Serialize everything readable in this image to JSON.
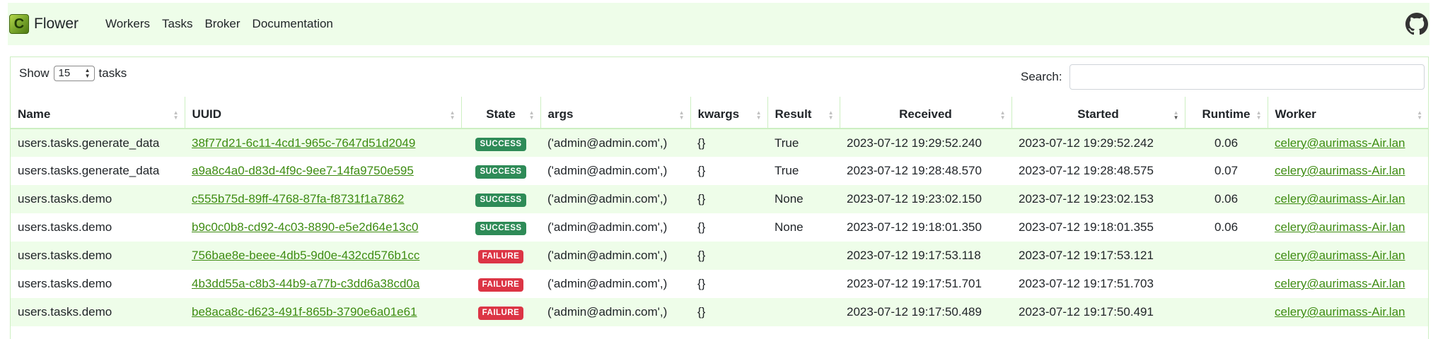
{
  "navbar": {
    "logo_letter": "C",
    "brand": "Flower",
    "links": [
      "Workers",
      "Tasks",
      "Broker",
      "Documentation"
    ],
    "github_icon": "github-icon"
  },
  "controls": {
    "show_label": "Show",
    "page_size": "15",
    "tasks_label": "tasks",
    "search_label": "Search:",
    "search_value": ""
  },
  "table": {
    "columns": [
      "Name",
      "UUID",
      "State",
      "args",
      "kwargs",
      "Result",
      "Received",
      "Started",
      "Runtime",
      "Worker"
    ],
    "sorted_column": "Started",
    "sort_direction": "descending",
    "rows": [
      {
        "name": "users.tasks.generate_data",
        "uuid": "38f77d21-6c11-4cd1-965c-7647d51d2049",
        "state": "SUCCESS",
        "args": "('admin@admin.com',)",
        "kwargs": "{}",
        "result": "True",
        "received": "2023-07-12 19:29:52.240",
        "started": "2023-07-12 19:29:52.242",
        "runtime": "0.06",
        "worker": "celery@aurimass-Air.lan"
      },
      {
        "name": "users.tasks.generate_data",
        "uuid": "a9a8c4a0-d83d-4f9c-9ee7-14fa9750e595",
        "state": "SUCCESS",
        "args": "('admin@admin.com',)",
        "kwargs": "{}",
        "result": "True",
        "received": "2023-07-12 19:28:48.570",
        "started": "2023-07-12 19:28:48.575",
        "runtime": "0.07",
        "worker": "celery@aurimass-Air.lan"
      },
      {
        "name": "users.tasks.demo",
        "uuid": "c555b75d-89ff-4768-87fa-f8731f1a7862",
        "state": "SUCCESS",
        "args": "('admin@admin.com',)",
        "kwargs": "{}",
        "result": "None",
        "received": "2023-07-12 19:23:02.150",
        "started": "2023-07-12 19:23:02.153",
        "runtime": "0.06",
        "worker": "celery@aurimass-Air.lan"
      },
      {
        "name": "users.tasks.demo",
        "uuid": "b9c0c0b8-cd92-4c03-8890-e5e2d64e13c0",
        "state": "SUCCESS",
        "args": "('admin@admin.com',)",
        "kwargs": "{}",
        "result": "None",
        "received": "2023-07-12 19:18:01.350",
        "started": "2023-07-12 19:18:01.355",
        "runtime": "0.06",
        "worker": "celery@aurimass-Air.lan"
      },
      {
        "name": "users.tasks.demo",
        "uuid": "756bae8e-beee-4db5-9d0e-432cd576b1cc",
        "state": "FAILURE",
        "args": "('admin@admin.com',)",
        "kwargs": "{}",
        "result": "",
        "received": "2023-07-12 19:17:53.118",
        "started": "2023-07-12 19:17:53.121",
        "runtime": "",
        "worker": "celery@aurimass-Air.lan"
      },
      {
        "name": "users.tasks.demo",
        "uuid": "4b3dd55a-c8b3-44b9-a77b-c3dd6a38cd0a",
        "state": "FAILURE",
        "args": "('admin@admin.com',)",
        "kwargs": "{}",
        "result": "",
        "received": "2023-07-12 19:17:51.701",
        "started": "2023-07-12 19:17:51.703",
        "runtime": "",
        "worker": "celery@aurimass-Air.lan"
      },
      {
        "name": "users.tasks.demo",
        "uuid": "be8aca8c-d623-491f-865b-3790e6a01e61",
        "state": "FAILURE",
        "args": "('admin@admin.com',)",
        "kwargs": "{}",
        "result": "",
        "received": "2023-07-12 19:17:50.489",
        "started": "2023-07-12 19:17:50.491",
        "runtime": "",
        "worker": "celery@aurimass-Air.lan"
      }
    ]
  },
  "colors": {
    "navbar_bg": "#eefde9",
    "link": "#3e8c12",
    "success": "#2e8b57",
    "failure": "#dc3545",
    "row_stripe": "#eefde9"
  }
}
